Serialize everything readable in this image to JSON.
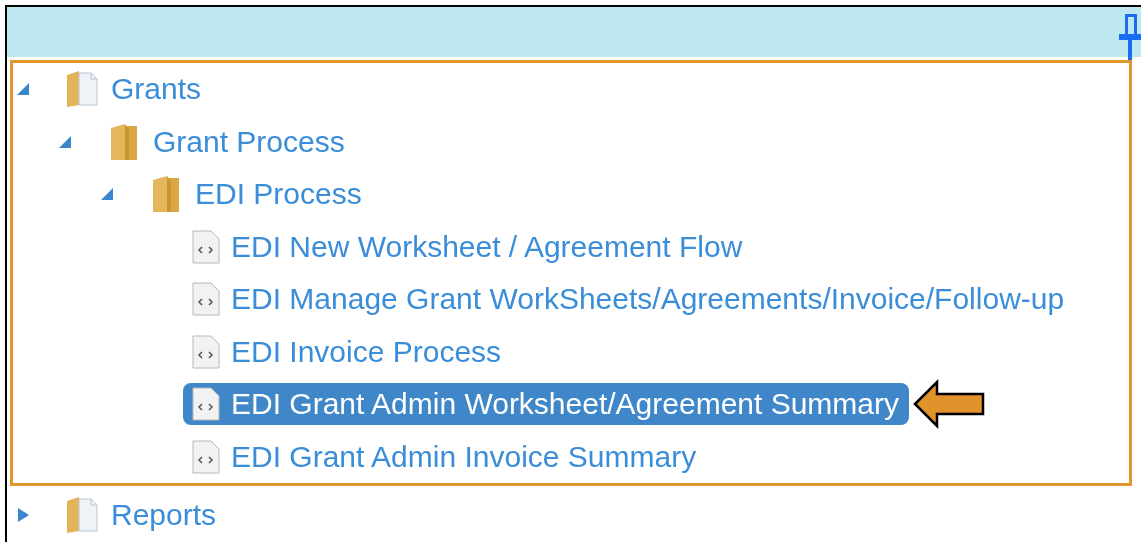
{
  "tree": [
    {
      "label": "Grants",
      "kind": "folder",
      "expanded": true,
      "highlighted": true,
      "selected": false,
      "children": [
        {
          "label": "Grant Process",
          "kind": "folder",
          "expanded": true,
          "selected": false,
          "children": [
            {
              "label": "EDI Process",
              "kind": "folder",
              "expanded": true,
              "selected": false,
              "children": [
                {
                  "label": "EDI New Worksheet / Agreement Flow",
                  "kind": "page",
                  "selected": false
                },
                {
                  "label": "EDI Manage Grant WorkSheets/Agreements/Invoice/Follow-up",
                  "kind": "page",
                  "selected": false
                },
                {
                  "label": "EDI Invoice Process",
                  "kind": "page",
                  "selected": false
                },
                {
                  "label": "EDI Grant Admin Worksheet/Agreement Summary",
                  "kind": "page",
                  "selected": true
                },
                {
                  "label": "EDI Grant Admin Invoice Summary",
                  "kind": "page",
                  "selected": false
                }
              ]
            }
          ]
        }
      ]
    },
    {
      "label": "Reports",
      "kind": "folder",
      "expanded": false,
      "highlighted": false,
      "selected": false
    }
  ]
}
